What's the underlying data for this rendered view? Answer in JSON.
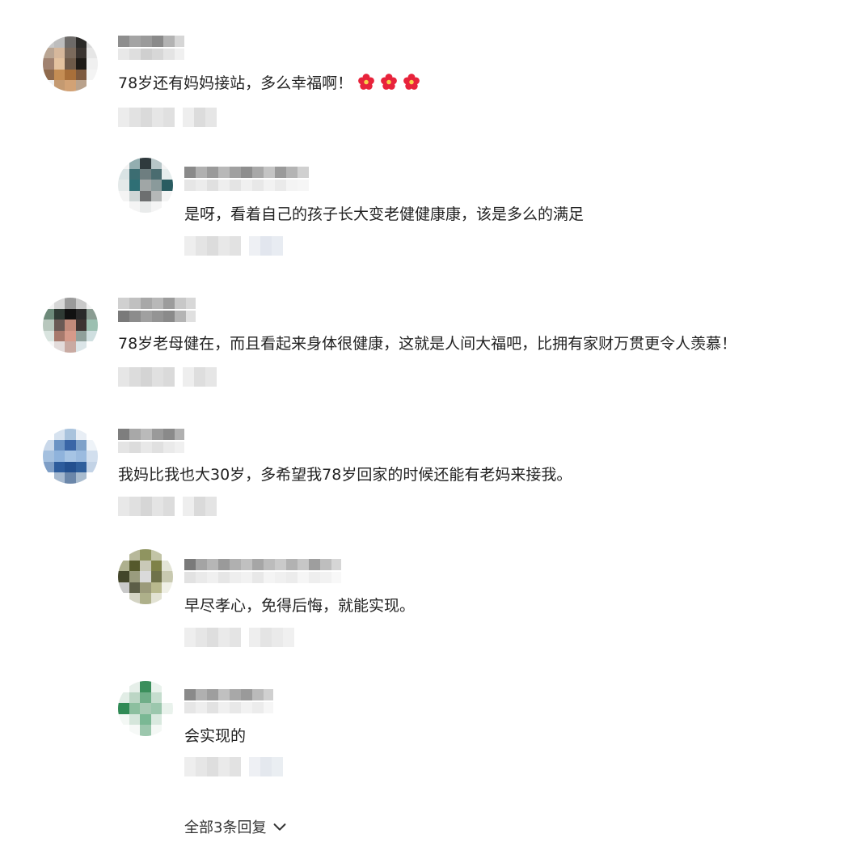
{
  "comments": [
    {
      "id": "c1",
      "text": "78岁还有妈妈接站，多么幸福啊！",
      "emoji_count": 3,
      "emoji_name": "red-flower-icon",
      "avatar_colors": [
        "#c9c9c9",
        "#bdbdbd",
        "#6d6a68",
        "#2b2a28",
        "#d9d9d9",
        "#b9a593",
        "#d6b89c",
        "#7b6a5c",
        "#3a3430",
        "#e6e6e6",
        "#a08270",
        "#e3c29f",
        "#6e5a49",
        "#1e1a16",
        "#f0f0f0",
        "#8f6a4d",
        "#c48d54",
        "#a86f3a",
        "#7d5a3f",
        "#f4f4f4",
        "#f0f0f0",
        "#c49a71",
        "#d2a275",
        "#b9a28c",
        "#ffffff"
      ],
      "reply": false
    },
    {
      "id": "c2",
      "text": "是呀，看着自己的孩子长大变老健健康康，该是多么的满足",
      "avatar_colors": [
        "#f4f4f4",
        "#93aeb0",
        "#2f3a3d",
        "#b7c6c8",
        "#f4f4f4",
        "#d9e3e4",
        "#3c6d72",
        "#6e7e80",
        "#4a6c70",
        "#e6eded",
        "#e4e9e9",
        "#2f6f75",
        "#a0a6a6",
        "#8a9a9b",
        "#2a5c61",
        "#f4f4f4",
        "#cfd6d6",
        "#6d6f70",
        "#b5b8b8",
        "#f4f4f4",
        "#ffffff",
        "#f4f4f4",
        "#e9ebeb",
        "#f4f4f4",
        "#ffffff"
      ],
      "reply": true
    },
    {
      "id": "c3",
      "text": "78岁老母健在，而且看起来身体很健康，这就是人间大福吧，比拥有家财万贯更令人羡慕！",
      "avatar_colors": [
        "#f4f4f4",
        "#d7d7d7",
        "#9a9a9a",
        "#c9c9c9",
        "#f4f4f4",
        "#6d8a7a",
        "#2f3a34",
        "#111111",
        "#2a2a2a",
        "#8a9c92",
        "#b8c7bd",
        "#6a5a55",
        "#c28b7b",
        "#3d3432",
        "#9cc0b1",
        "#d9e4df",
        "#a77a6d",
        "#d59a8a",
        "#8fa09b",
        "#cfdfe0",
        "#f6f6f6",
        "#e3dcdb",
        "#c9aaa2",
        "#dbe5e8",
        "#ffffff"
      ],
      "reply": false
    },
    {
      "id": "c4",
      "text": "我妈比我也大30岁，多希望我78岁回家的时候还能有老妈来接我。",
      "avatar_colors": [
        "#ffffff",
        "#d6e2ef",
        "#a9c3dd",
        "#e8eef5",
        "#ffffff",
        "#c9d8ea",
        "#6b93c4",
        "#3a66a7",
        "#7ea1c9",
        "#eef3f8",
        "#a4c0df",
        "#8fb3dc",
        "#a6c4e4",
        "#9bbbdf",
        "#d2dfee",
        "#7e9ec6",
        "#2d5c9c",
        "#23508f",
        "#2f5f9c",
        "#c3d3e6",
        "#ffffff",
        "#a6b9cf",
        "#6b87aa",
        "#a9bccf",
        "#ffffff"
      ],
      "reply": false
    },
    {
      "id": "c5",
      "text": "早尽孝心，免得后悔，就能实现。",
      "avatar_colors": [
        "#ffffff",
        "#b7b89a",
        "#8f9460",
        "#c2c4a6",
        "#ffffff",
        "#aeb08e",
        "#55592c",
        "#c9c9b8",
        "#7f8248",
        "#e3e4d6",
        "#43462a",
        "#9a9c7e",
        "#dadada",
        "#6f724a",
        "#c8c9b0",
        "#c9c9c9",
        "#5c5e47",
        "#9b9a7a",
        "#b9b98e",
        "#f0f0e6",
        "#ffffff",
        "#d4d4c4",
        "#aeb08a",
        "#e2e2d3",
        "#ffffff"
      ],
      "reply": true
    },
    {
      "id": "c6",
      "text": "会实现的",
      "avatar_colors": [
        "#ffffff",
        "#e6efe9",
        "#3b8f5c",
        "#e9f2ec",
        "#ffffff",
        "#e2ede6",
        "#bcd6c5",
        "#6fae88",
        "#c5ddce",
        "#ffffff",
        "#2f8a55",
        "#8cbf9f",
        "#a9cbb5",
        "#9bc7ad",
        "#e9f2ec",
        "#f4f8f5",
        "#d5e6db",
        "#7ab894",
        "#d9e9df",
        "#ffffff",
        "#ffffff",
        "#f6f9f7",
        "#9cc7ad",
        "#f4f8f5",
        "#ffffff"
      ],
      "reply": true
    }
  ],
  "more_replies": {
    "label": "全部3条回复",
    "icon": "chevron-down-icon"
  },
  "colors": {
    "text": "#222222",
    "blur_dark": "#7c7c7c",
    "blur_light": "#e2e2e2",
    "flower": "#e8233b"
  }
}
